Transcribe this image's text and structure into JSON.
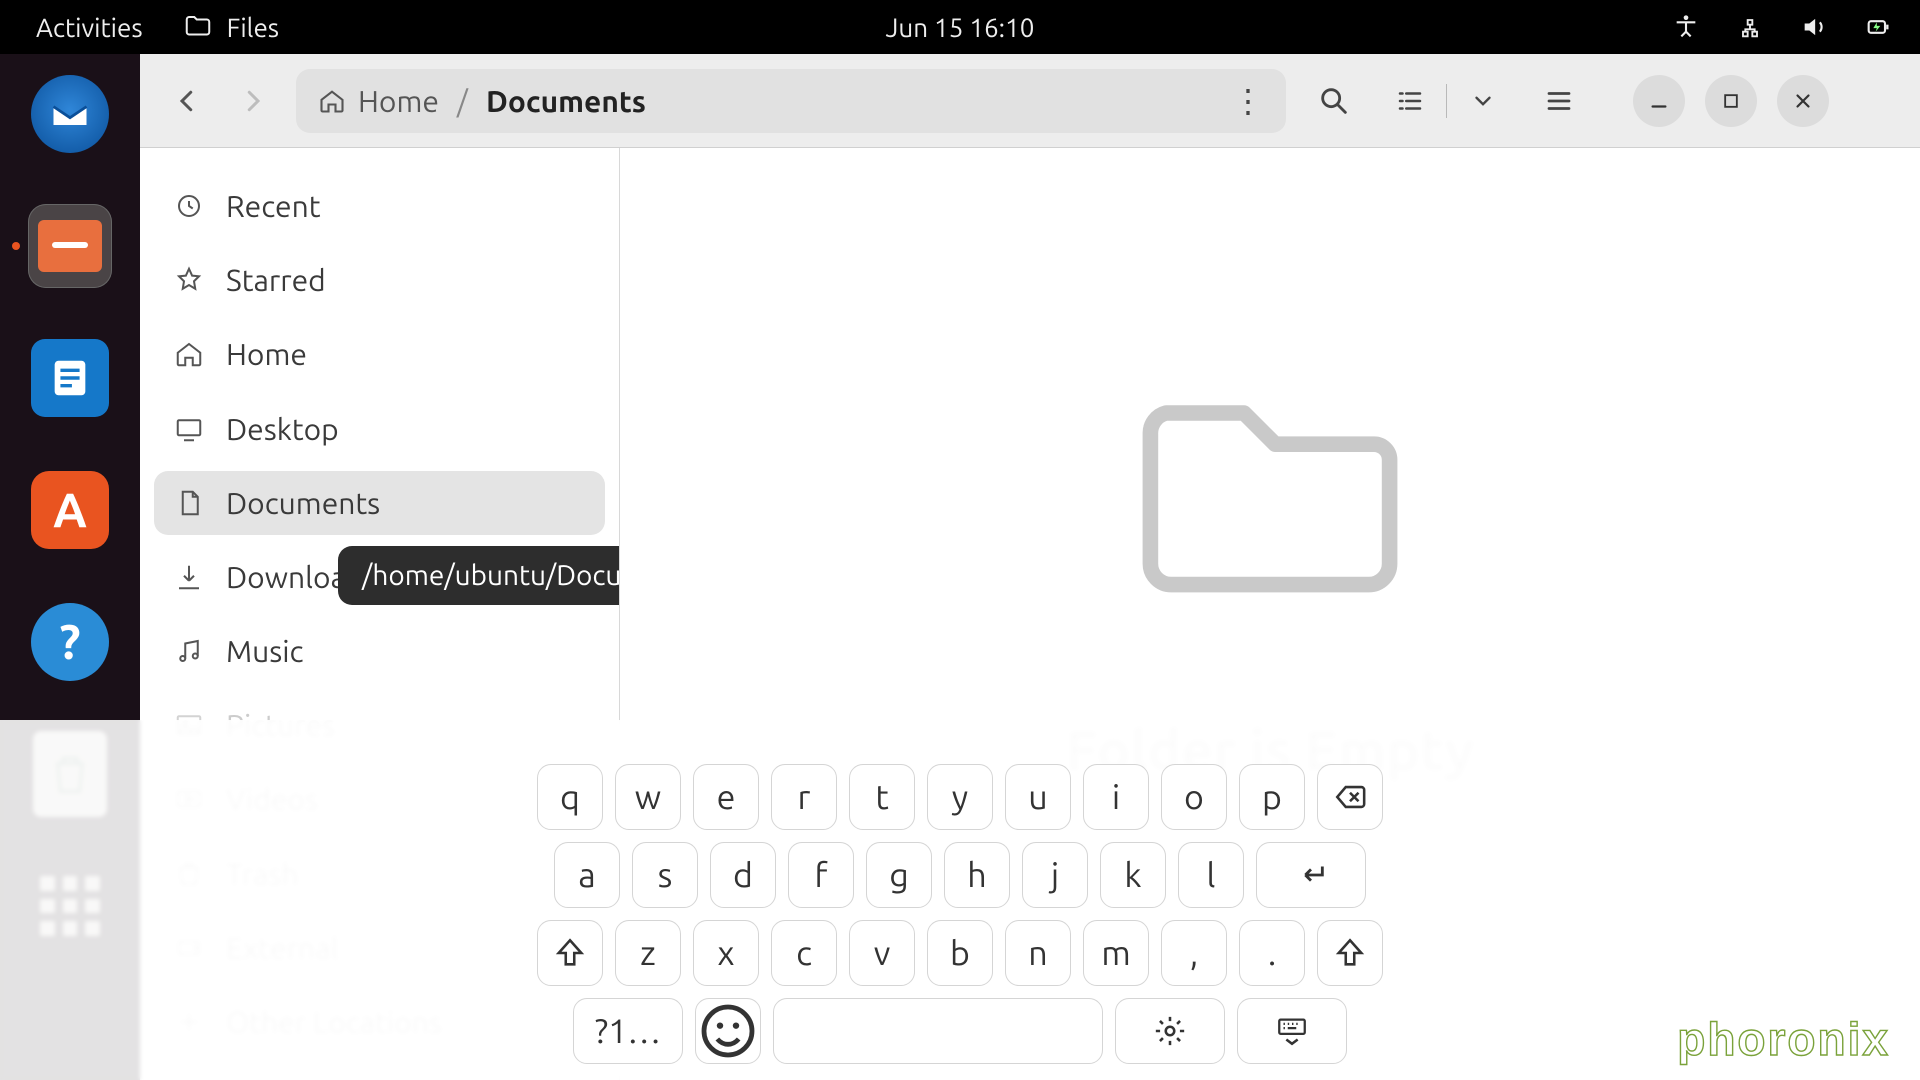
{
  "panel": {
    "activities": "Activities",
    "app_label": "Files",
    "clock": "Jun 15  16:10"
  },
  "dock": {
    "items": [
      {
        "name": "thunderbird"
      },
      {
        "name": "files",
        "active": true
      },
      {
        "name": "libreoffice-writer"
      },
      {
        "name": "ubuntu-software"
      },
      {
        "name": "help"
      },
      {
        "name": "trash"
      },
      {
        "name": "show-applications"
      }
    ]
  },
  "fm": {
    "breadcrumb": {
      "home": "Home",
      "current": "Documents",
      "separator": "/"
    },
    "tooltip": "/home/ubuntu/Documents",
    "empty_label": "Folder is Empty",
    "sidebar": [
      {
        "id": "recent",
        "label": "Recent"
      },
      {
        "id": "starred",
        "label": "Starred"
      },
      {
        "id": "home",
        "label": "Home"
      },
      {
        "id": "desktop",
        "label": "Desktop"
      },
      {
        "id": "documents",
        "label": "Documents",
        "selected": true
      },
      {
        "id": "downloads",
        "label": "Downloads"
      },
      {
        "id": "music",
        "label": "Music"
      },
      {
        "id": "pictures",
        "label": "Pictures",
        "faded": true
      },
      {
        "id": "videos",
        "label": "Videos",
        "faded": true
      },
      {
        "id": "trash",
        "label": "Trash",
        "faded": true
      },
      {
        "id": "external",
        "label": "External",
        "faded": true
      },
      {
        "id": "other",
        "label": "Other Locations",
        "faded": true
      }
    ]
  },
  "osk": {
    "rows": [
      [
        "q",
        "w",
        "e",
        "r",
        "t",
        "y",
        "u",
        "i",
        "o",
        "p"
      ],
      [
        "a",
        "s",
        "d",
        "f",
        "g",
        "h",
        "j",
        "k",
        "l"
      ],
      [
        "z",
        "x",
        "c",
        "v",
        "b",
        "n",
        "m",
        ",",
        "."
      ]
    ],
    "symbols_key": "?1…"
  },
  "watermark": "phoronix"
}
